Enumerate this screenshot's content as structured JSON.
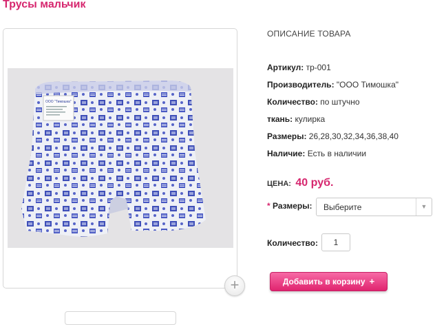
{
  "product": {
    "title": "Трусы мальчик"
  },
  "description": {
    "heading": "ОПИСАНИЕ ТОВАРА",
    "specs": [
      {
        "label": "Артикул:",
        "value": " тр-001"
      },
      {
        "label": "Производитель:",
        "value": " \"ООО Тимошка\""
      },
      {
        "label": "Количество:",
        "value": " по штучно"
      },
      {
        "label": "ткань:",
        "value": " кулирка"
      },
      {
        "label": "Размеры:",
        "value": " 26,28,30,32,34,36,38,40"
      },
      {
        "label": "Наличие:",
        "value": " Есть в наличии"
      }
    ]
  },
  "price": {
    "label": "ЦЕНА:",
    "value": "40 руб."
  },
  "options": {
    "size_required_marker": "*",
    "size_label": "Размеры:",
    "size_selected": "Выберите"
  },
  "quantity": {
    "label": "Количество:",
    "value": "1"
  },
  "cart": {
    "button_label": "Добавить в корзину",
    "button_icon": "+"
  },
  "icons": {
    "zoom": "plus-icon",
    "select_arrow": "chevron-down-icon"
  },
  "colors": {
    "accent": "#d6266e",
    "button_top": "#f76aa5",
    "button_bottom": "#e0246f",
    "fabric_blue": "#3f4fb8"
  },
  "label_tag": {
    "brand": "ООО \"Тимошка\""
  }
}
